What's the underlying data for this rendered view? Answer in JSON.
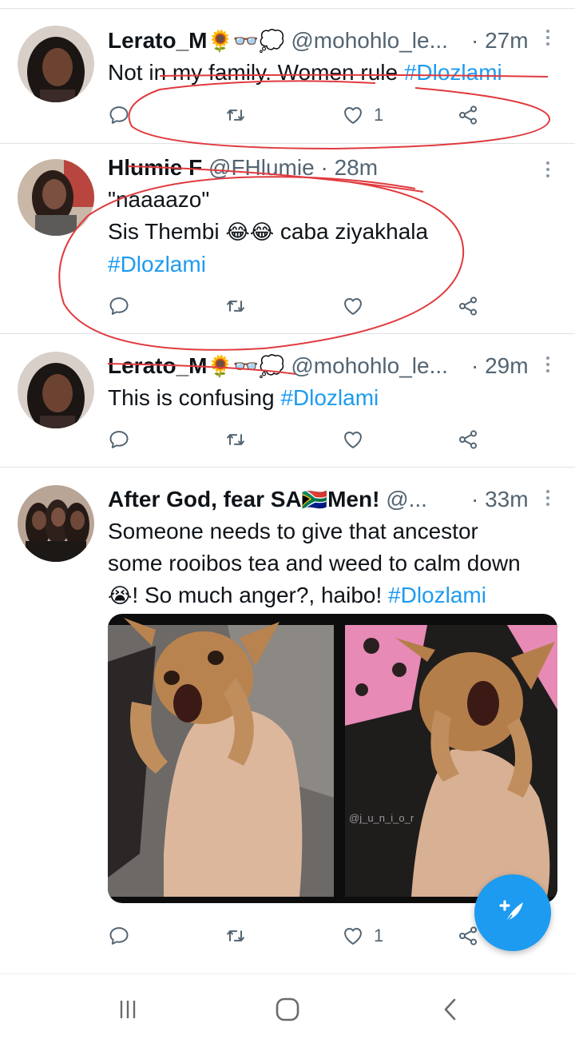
{
  "tweets": [
    {
      "name": "Lerato_M",
      "name_emoji": "🌻👓💭",
      "handle": "@mohohlo_le...",
      "time": "· 27m",
      "text": "Not in my family. Women rule ",
      "hashtag": "#Dlozlami",
      "likes": "1"
    },
    {
      "name": "Hlumie F",
      "handle": "@FHlumie",
      "time": "· 28m",
      "line1": "\"naaaazo\"",
      "line2_text": "Sis Thembi ",
      "line2_emoji": "😂😂",
      "line2_rest": " caba ziyakhala",
      "hashtag": "#Dlozlami",
      "likes": ""
    },
    {
      "name": "Lerato_M",
      "name_emoji": "🌻👓💭",
      "handle": "@mohohlo_le...",
      "time": "· 29m",
      "text": "This is confusing ",
      "hashtag": "#Dlozlami",
      "likes": ""
    },
    {
      "name_part1": "After God, fear SA",
      "flag": "🇿🇦",
      "name_part2": "Men!",
      "handle": "@...",
      "time": "· 33m",
      "line1": "Someone needs to give that ancestor",
      "line2": "some rooibos tea and weed to calm down",
      "line3_emoji": "😭",
      "line3_text": "! So much anger?, haibo! ",
      "hashtag": "#Dlozlami",
      "watermark": "@j_u_n_i_o_r",
      "likes": "1"
    }
  ],
  "colors": {
    "accent": "#1d9bf0",
    "text": "#0f1419",
    "secondary": "#536471",
    "annotation": "#e03a3e"
  },
  "icons": {
    "reply": "reply-icon",
    "retweet": "retweet-icon",
    "like": "heart-icon",
    "share": "share-icon",
    "more": "more-vertical-icon",
    "compose": "compose-icon",
    "recents": "recents-icon",
    "home": "home-icon",
    "back": "back-icon"
  }
}
